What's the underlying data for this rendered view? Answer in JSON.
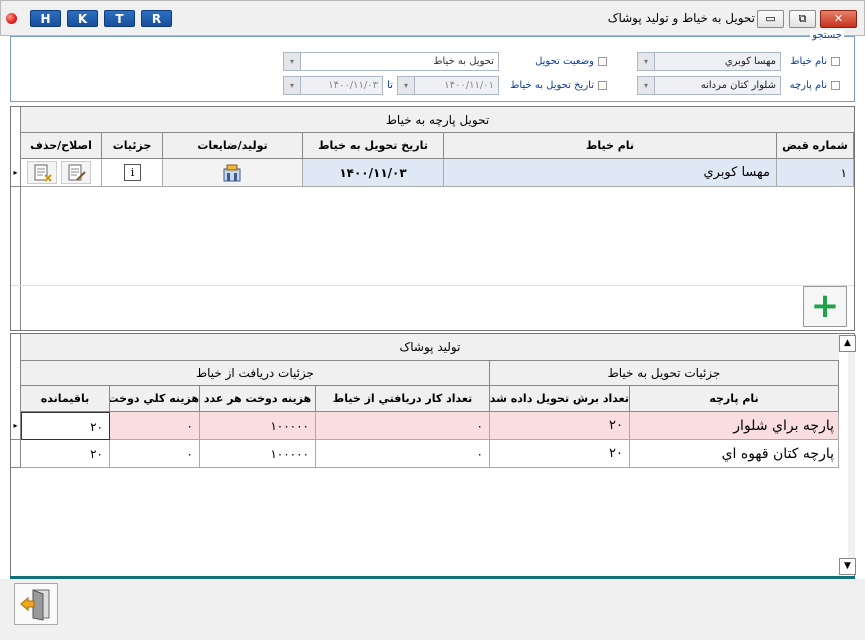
{
  "window": {
    "title": "تحويل به خياط و توليد پوشاک",
    "hotkeys": [
      "H",
      "K",
      "T",
      "R"
    ],
    "min_label": "▭",
    "restore_label": "⧉",
    "close_label": "✕"
  },
  "search": {
    "legend": "جستجو",
    "tailor_name_label": "نام خياط",
    "tailor_name_value": "مهسا کوبري",
    "fabric_name_label": "نام پارچه",
    "fabric_name_value": "شلوار کتان مردانه",
    "delivery_status_label": "وضعيت تحويل",
    "delivery_status_value": "تحويل به خياط",
    "delivery_date_label": "تاريخ تحويل به خياط",
    "date_from": "۱۴۰۰/۱۱/۰۱",
    "date_to_label": "تا",
    "date_to": "۱۴۰۰/۱۱/۰۳"
  },
  "grid1": {
    "caption": "تحويل پارچه به خياط",
    "columns": [
      "شماره قبض",
      "نام خياط",
      "تاريخ تحويل به خياط",
      "توليد/ضايعات",
      "جزئيات",
      "اصلاح/حذف"
    ],
    "rows": [
      {
        "receipt_no": "۱",
        "tailor": "مهسا کوبري",
        "date": "۱۴۰۰/۱۱/۰۳"
      }
    ],
    "add_label": "+"
  },
  "grid2": {
    "caption": "توليد پوشاک",
    "group_right": "جزئيات تحويل به خياط",
    "group_left": "جزئيات دريافت از خياط",
    "columns": [
      "نام پارچه",
      "تعداد برش تحويل داده شده",
      "تعداد کار دريافتي از خياط",
      "هزينه دوخت هر عدد",
      "هزينه کلي دوخت",
      "باقيمانده"
    ],
    "rows": [
      {
        "fabric": "پارچه براي شلوار",
        "cut_count": "۲۰",
        "received": "۰",
        "unit_cost": "۱۰۰۰۰۰",
        "total_cost": "۰",
        "remaining": "۲۰"
      },
      {
        "fabric": "پارچه کتان قهوه اي",
        "cut_count": "۲۰",
        "received": "۰",
        "unit_cost": "۱۰۰۰۰۰",
        "total_cost": "۰",
        "remaining": "۲۰"
      }
    ]
  },
  "icons": {
    "row_pointer": "▸",
    "combo_arrow": "▾",
    "scroll_up": "▲",
    "scroll_down": "▼",
    "info": "i"
  },
  "colors": {
    "hotkey_blue": "#1a4f9c",
    "selected_row": "#dfe8f5",
    "pink_row": "#f9dde0",
    "add_green": "#1ea34a",
    "divider_teal": "#11707a"
  }
}
